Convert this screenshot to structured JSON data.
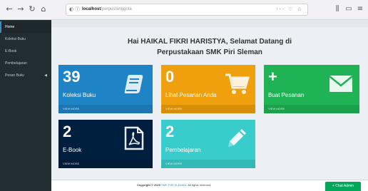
{
  "browser": {
    "url_host": "localhost",
    "url_path": "/perpus/anggota",
    "url_actions": "··· ♡ ☆"
  },
  "sidebar": {
    "items": [
      {
        "label": "Home"
      },
      {
        "label": "Koleksi Buku"
      },
      {
        "label": "E-Book"
      },
      {
        "label": "Pembelajaran"
      },
      {
        "label": "Pesan Buku"
      }
    ],
    "pesan_caret": "◀"
  },
  "main": {
    "greeting_line1": "Hai HAIKAL FIKRI HARISTYA, Selamat Datang di",
    "greeting_line2": "Perpustakaan SMK Piri Sleman"
  },
  "boxes": [
    {
      "count": "39",
      "label": "Koleksi Buku",
      "footer": "VIEW MORE",
      "icon": "book-icon",
      "color": "#1f84c6"
    },
    {
      "count": "0",
      "label": "Lihat Pesanan Anda",
      "footer": "VIEW MORE",
      "icon": "cart-icon",
      "color": "#f0a00c"
    },
    {
      "count": "+",
      "label": "Buat Pesanan",
      "footer": "VIEW MORE",
      "icon": "envelope-icon",
      "color": "#1fb355"
    },
    {
      "count": "2",
      "label": "E-Book",
      "footer": "VIEW MORE",
      "icon": "pdf-file-icon",
      "color": "#001f3f"
    },
    {
      "count": "2",
      "label": "Pembelajaran",
      "footer": "VIEW MORE",
      "icon": "pencil-icon",
      "color": "#39cccc"
    }
  ],
  "footer": {
    "copyright_prefix": "Copyright © 2020",
    "brand": "SMK PIRI SLEMAN",
    "suffix": ". All rights reserved."
  },
  "chat": {
    "label": "+ Chat Admin"
  }
}
